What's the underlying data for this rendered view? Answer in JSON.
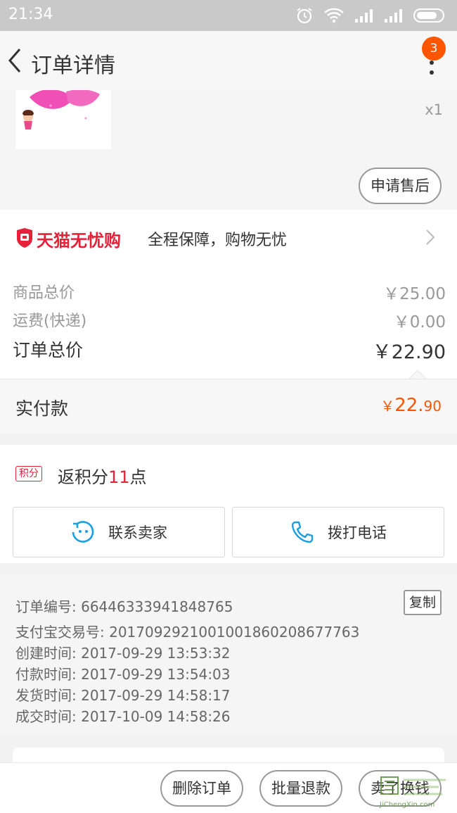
{
  "status_bar": {
    "time": "21:34",
    "icons": [
      "alarm-icon",
      "wifi-icon",
      "signal-icon",
      "signal-icon",
      "battery-icon"
    ]
  },
  "nav": {
    "title": "订单详情",
    "badge_count": "3"
  },
  "product": {
    "quantity": "x1",
    "aftersale_label": "申请售后"
  },
  "tmall": {
    "name": "天猫无忧购",
    "slogan": "全程保障，购物无忧",
    "brand_color": "#e6213a"
  },
  "prices": {
    "goods_total_label": "商品总价",
    "goods_total": "￥25.00",
    "shipping_label": "运费(快递)",
    "shipping": "￥0.00",
    "order_total_label": "订单总价",
    "order_total": "￥22.90"
  },
  "payment": {
    "label": "实付款",
    "currency": "￥",
    "integer": "22.",
    "decimal": "90",
    "accent": "#ff5500"
  },
  "points": {
    "tag": "积分",
    "prefix": "返积分",
    "count": "11",
    "suffix": "点"
  },
  "contact": {
    "seller_label": "联系卖家",
    "call_label": "拨打电话"
  },
  "order_info": {
    "order_no": "订单编号: 664463339418487​65",
    "alipay_no": "支付宝交易号: 2017092921001001860208677763",
    "created": "创建时间: 2017-09-29 13:53:32",
    "paid": "付款时间: 2017-09-29 13:54:03",
    "shipped": "发货时间: 2017-09-29 14:58:17",
    "completed": "成交时间: 2017-10-09 14:58:26",
    "copy_label": "复制"
  },
  "actions": {
    "delete_label": "删除订单",
    "batch_refund_label": "批量退款",
    "swap_label": "卖了换钱"
  },
  "watermark": {
    "url": "JiChengXin.com"
  }
}
